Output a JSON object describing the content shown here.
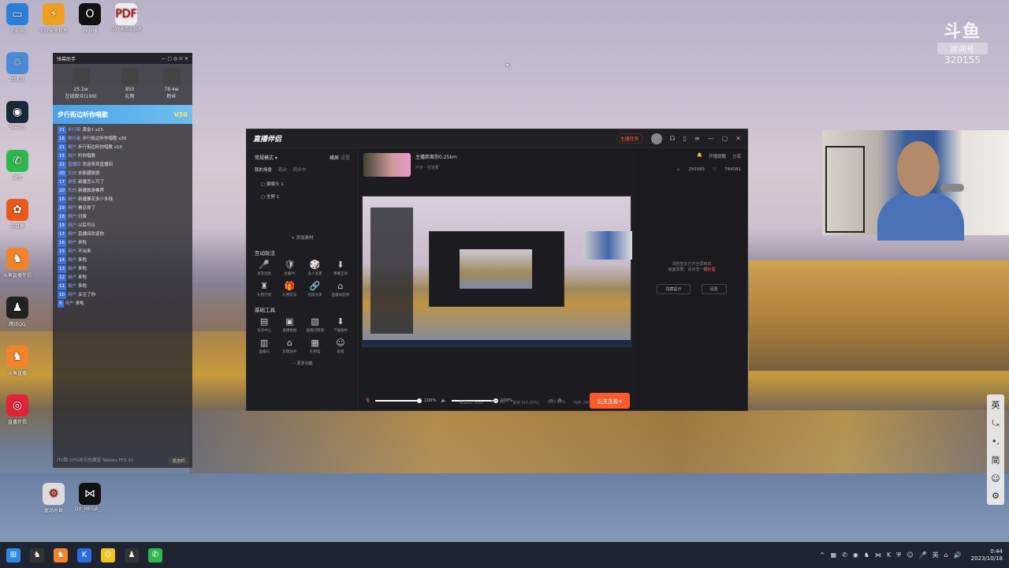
{
  "desktop": {
    "icons": [
      {
        "label": "此电脑",
        "glyph": "▭",
        "color": "#2a7ed8"
      },
      {
        "label": "回收站",
        "glyph": "♲",
        "color": "#4a8ad8"
      },
      {
        "label": "Steam",
        "glyph": "◉",
        "color": "#1b2838"
      },
      {
        "label": "微信",
        "glyph": "✆",
        "color": "#2db84d"
      },
      {
        "label": "向日葵",
        "glyph": "✿",
        "color": "#e85a1a"
      },
      {
        "label": "斗鱼直播伴侣",
        "glyph": "♞",
        "color": "#f2832a"
      },
      {
        "label": "腾讯QQ",
        "glyph": "♟",
        "color": "#222"
      },
      {
        "label": "斗鱼直播",
        "glyph": "♞",
        "color": "#f2832a"
      },
      {
        "label": "直播伴侣",
        "glyph": "◎",
        "color": "#e2233a"
      }
    ],
    "icons_col2": [
      {
        "label": "火绒安全软件",
        "glyph": "⚡",
        "color": "#f0a020"
      },
      {
        "label": "YY开播",
        "glyph": "O",
        "color": "#111"
      },
      {
        "label": "DXMEGA.pdf",
        "glyph": "PDF",
        "color": "#eee"
      }
    ],
    "icons_bottom": [
      {
        "label": "驱动总裁",
        "glyph": "⚙",
        "color": "#ddd"
      },
      {
        "label": "DX_MEGA_...",
        "glyph": "⋈",
        "color": "#111"
      }
    ]
  },
  "chat": {
    "title": "弹幕助手",
    "stats": [
      {
        "label": "在线观众(199)",
        "value": "25.1w"
      },
      {
        "label": "礼物",
        "value": "850"
      },
      {
        "label": "粉丝",
        "value": "78.4w"
      }
    ],
    "gift_banner": "步行街边听你唱歌",
    "gift_level": "V50",
    "messages": [
      {
        "lv": "21",
        "name": "步行街",
        "text": "黄金1 x15"
      },
      {
        "lv": "18",
        "name": "旅行者",
        "text": "步行街边听你唱歌 x30"
      },
      {
        "lv": "21",
        "name": "用户",
        "text": "步行街边听你唱歌 x10"
      },
      {
        "lv": "15",
        "name": "用户",
        "text": "听你唱歌"
      },
      {
        "lv": "22",
        "name": "直播间",
        "text": "欢迎来到直播间"
      },
      {
        "lv": "20",
        "name": "大白",
        "text": "去新疆旅游"
      },
      {
        "lv": "17",
        "name": "游客",
        "text": "新疆怎么可了"
      },
      {
        "lv": "20",
        "name": "大白",
        "text": "新疆旅游推荐"
      },
      {
        "lv": "16",
        "name": "用户",
        "text": "新疆要花多少多钱"
      },
      {
        "lv": "19",
        "name": "用户",
        "text": "看见你了"
      },
      {
        "lv": "18",
        "name": "用户",
        "text": "付费"
      },
      {
        "lv": "19",
        "name": "用户",
        "text": "以后可以"
      },
      {
        "lv": "17",
        "name": "用户",
        "text": "直播间欢迎你"
      },
      {
        "lv": "16",
        "name": "用户",
        "text": "来啦"
      },
      {
        "lv": "15",
        "name": "用户",
        "text": "不出来"
      },
      {
        "lv": "14",
        "name": "用户",
        "text": "来啦"
      },
      {
        "lv": "13",
        "name": "用户",
        "text": "来啦"
      },
      {
        "lv": "12",
        "name": "用户",
        "text": "来啦"
      },
      {
        "lv": "11",
        "name": "用户",
        "text": "来啦"
      },
      {
        "lv": "10",
        "name": "用户",
        "text": "关注了你"
      },
      {
        "lv": "9",
        "name": "用户",
        "text": "来啦"
      }
    ],
    "footer_text": "ITV跑 50%欢乐的满宝 Tablets FPS 30",
    "footer_button": "状态栏"
  },
  "app": {
    "logo": "直播伴侣",
    "titlebar_tag": "主播任务",
    "mode": "常规模式 ▾",
    "mode_actions": [
      "横屏",
      "设置"
    ],
    "scene_tabs": [
      "我的场景",
      "观众",
      "同步中"
    ],
    "scenes": [
      "摄像头 1",
      "全屏 1"
    ],
    "add_source": "+ 添加素材",
    "section1": "互动玩法",
    "tools1": [
      {
        "g": "🎤",
        "label": "语音连麦"
      },
      {
        "g": "🛡",
        "label": "主播PK"
      },
      {
        "g": "🎲",
        "label": "多人连麦"
      },
      {
        "g": "⬇",
        "label": "弹幕互动"
      },
      {
        "g": "♜",
        "label": "礼物打榜"
      },
      {
        "g": "🎁",
        "label": "礼物玩法"
      },
      {
        "g": "🔗",
        "label": "投屏分享"
      },
      {
        "g": "⌂",
        "label": "直播间装修"
      }
    ],
    "section2": "基础工具",
    "tools2": [
      {
        "g": "▤",
        "label": "任务中心"
      },
      {
        "g": "▣",
        "label": "直播数据"
      },
      {
        "g": "▧",
        "label": "直播间管理"
      },
      {
        "g": "⬇",
        "label": "下载素材"
      },
      {
        "g": "▥",
        "label": "直播间"
      },
      {
        "g": "⌂",
        "label": "房管助手"
      },
      {
        "g": "▦",
        "label": "礼物墙"
      },
      {
        "g": "☺",
        "label": "表情"
      }
    ],
    "more": "··· 更多功能",
    "streamer_name": "主播距离你0.25km",
    "streamer_sub": "户外 · 生活秀",
    "mic_level": "100%",
    "speaker_level": "100%",
    "golive": "关闭直播 ▾",
    "top_actions": [
      "开播提醒",
      "分享"
    ],
    "fans": "250585",
    "likes": "784081",
    "hint_line1": "请检查多已开全屏映出",
    "hint_line2": "画面需要，请点击",
    "hint_link": "一键处理",
    "hint_buttons": [
      "隐藏提示",
      "设置"
    ],
    "status": [
      "码率817kb/s",
      "FPS 30",
      "丢帧 0(0.00%)",
      "CPU 30%",
      "内存 24%",
      "02:39:37"
    ]
  },
  "watermark": {
    "brand": "斗鱼",
    "room_label": "房间号",
    "room_no": "320155"
  },
  "ime": [
    "英",
    "⤿",
    "•,",
    "简",
    "☺",
    "⚙"
  ],
  "taskbar": {
    "apps": [
      {
        "g": "⊞",
        "c": "#2c8be8"
      },
      {
        "g": "♞",
        "c": "#333"
      },
      {
        "g": "♞",
        "c": "#f2832a"
      },
      {
        "g": "K",
        "c": "#2a6be0"
      },
      {
        "g": "O",
        "c": "#f3c320"
      },
      {
        "g": "♟",
        "c": "#333"
      },
      {
        "g": "✆",
        "c": "#2db84d"
      }
    ],
    "tray": [
      "^",
      "▦",
      "✆",
      "◉",
      "♞",
      "⋈",
      "K",
      "⛨",
      "☺",
      "🎤",
      "英",
      "⌂",
      "🔊"
    ],
    "time": "0:44",
    "date": "2023/10/18"
  }
}
